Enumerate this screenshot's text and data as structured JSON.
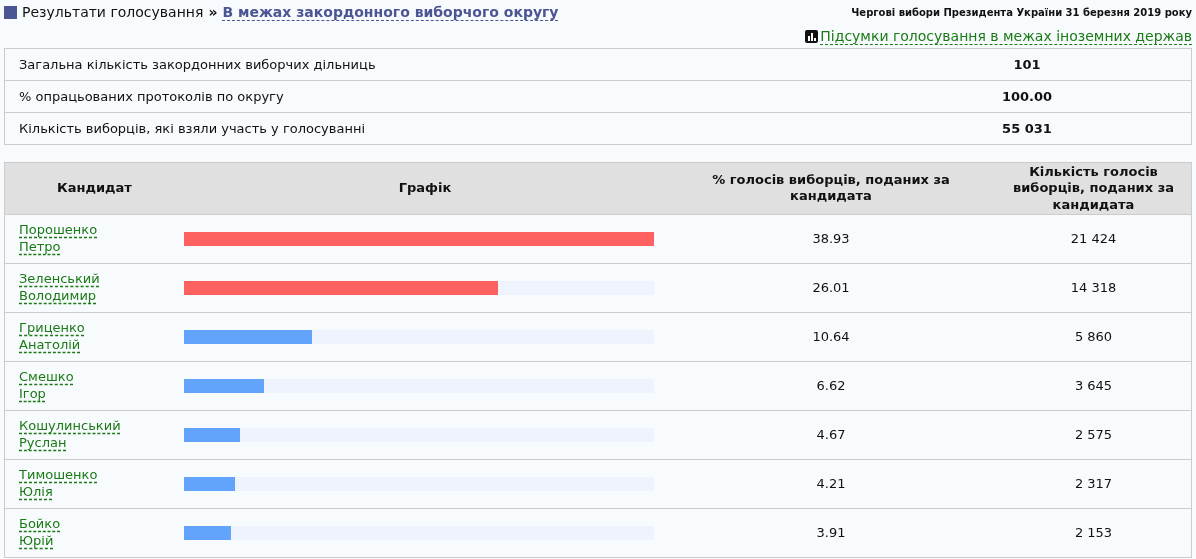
{
  "breadcrumb": {
    "root": "Результати голосування",
    "separator": "»",
    "current": "В межах закордонного виборчого округу"
  },
  "election_title": "Чергові вибори Президента України 31 березня 2019 року",
  "summary_link": "Підсумки голосування в межах іноземних держав",
  "summary": [
    {
      "label": "Загальна кількість закордонних виборчих дільниць",
      "value": "101"
    },
    {
      "label": "% опрацьованих протоколів по округу",
      "value": "100.00"
    },
    {
      "label": "Кількість виборців, які взяли участь у голосуванні",
      "value": "55 031"
    }
  ],
  "table": {
    "columns": [
      "Кандидат",
      "Графік",
      "% голосів виборців, поданих за кандидата",
      "Кількість голосів виборців, поданих за кандидата"
    ],
    "rows": [
      {
        "candidate": "Порошенко Петро",
        "level": 1,
        "color": "#ff6161",
        "percent": "38.93",
        "votes": "21 424"
      },
      {
        "candidate": "Зеленський Володимир",
        "level": 0.668,
        "color": "#ff6161",
        "percent": "26.01",
        "votes": "14 318"
      },
      {
        "candidate": "Гриценко Анатолій",
        "level": 0.273,
        "color": "#62a4fc",
        "percent": "10.64",
        "votes": "5 860"
      },
      {
        "candidate": "Смешко Ігор",
        "level": 0.17,
        "color": "#62a4fc",
        "percent": "6.62",
        "votes": "3 645"
      },
      {
        "candidate": "Кошулинський Руслан",
        "level": 0.12,
        "color": "#62a4fc",
        "percent": "4.67",
        "votes": "2 575"
      },
      {
        "candidate": "Тимошенко Юлія",
        "level": 0.108,
        "color": "#62a4fc",
        "percent": "4.21",
        "votes": "2 317"
      },
      {
        "candidate": "Бойко Юрій",
        "level": 0.1,
        "color": "#62a4fc",
        "percent": "3.91",
        "votes": "2 153"
      }
    ]
  }
}
